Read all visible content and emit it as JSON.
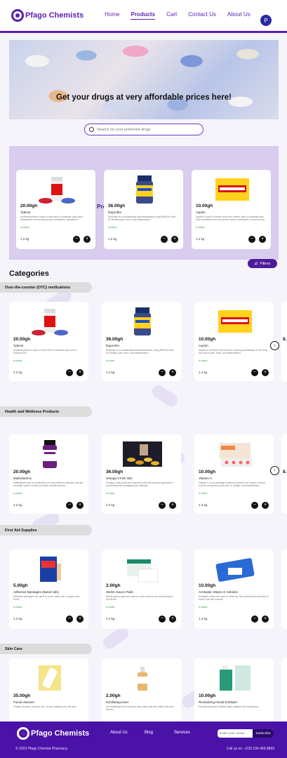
{
  "brand": {
    "name": "Pfago Chemists",
    "footer_name": "Pfago Chemists",
    "accent": "#5b1fae",
    "footer_bg": "#4b12a8"
  },
  "nav": {
    "links": [
      "Home",
      "Products",
      "Cart",
      "Contact Us",
      "About Us"
    ],
    "active": "Products",
    "avatar_initial": "P"
  },
  "hero": {
    "title": "Get your drugs at  very affordable prices here!"
  },
  "search": {
    "placeholder": "Search for your preferred drugs"
  },
  "featured": {
    "label": "Products",
    "items": [
      {
        "price": "20.00gh",
        "name": "Tylenol",
        "desc": "Acetaminophen is used to treat mild to moderate pain (from headaches, menstrual periods, toothaches, backaches, osteoarthritis, or cold/flu aches and pains) and to reduce fever.",
        "stock": "In stock",
        "weight": "1.2 kg",
        "image": "tylenol-bottle"
      },
      {
        "price": "36.00gh",
        "name": "Ibuprofen",
        "desc": "Ibuprofen is a nonsteroidal anti-inflammatory drug (NSAID) used for treating pain, fever, and inflammation.",
        "stock": "In stock",
        "weight": "1.2 kg",
        "image": "ibuprofen-bottle"
      },
      {
        "price": "10.00gh",
        "name": "Aspirin",
        "desc": "Aspirin is used to reduce fever and relieve mild to moderate pain from conditions such as muscle aches, toothaches, common cold, and headaches.",
        "stock": "In stock",
        "weight": "1.2 kg",
        "image": "aspirin-box"
      }
    ]
  },
  "filters_label": "Filters",
  "categories_title": "Categories",
  "categories": [
    {
      "name": "Over-the-counter (OTC) medications",
      "items": [
        {
          "price": "20.00gh",
          "name": "Tylenol",
          "desc": "Acetaminophen is used to treat mild to moderate pain and to reduce fever.",
          "stock": "In stock",
          "weight": "1.2 kg",
          "image": "tylenol-bottle"
        },
        {
          "price": "36.00gh",
          "name": "Ibuprofen",
          "desc": "Ibuprofen is a nonsteroidal anti-inflammatory drug (NSAID) used for treating pain, fever, and inflammation.",
          "stock": "In stock",
          "weight": "1.2 kg",
          "image": "ibuprofen-bottle"
        },
        {
          "price": "10.00gh",
          "name": "Aspirin",
          "desc": "Aspirin is a NSAID that works by reducing substances in the body that cause pain, fever, and inflammation.",
          "stock": "In stock",
          "weight": "1.2 kg",
          "image": "aspirin-box"
        }
      ],
      "peek_price": "8."
    },
    {
      "name": "Health and Wellness Products",
      "items": [
        {
          "price": "20.00gh",
          "name": "Multivitamins",
          "desc": "Multivitamins are a combination of many different vitamins that are normally found in foods and other natural sources.",
          "stock": "In stock",
          "weight": "1.2 kg",
          "image": "multivitamin-bottle"
        },
        {
          "price": "36.00gh",
          "name": "Omega-3 Fish Oils",
          "desc": "Omega-3 fatty acids are essential nutrients that are important in preventing and managing heart disease.",
          "stock": "In stock",
          "weight": "1.2 kg",
          "image": "fish-oil-capsules"
        },
        {
          "price": "10.00gh",
          "name": "Vitamin C",
          "desc": "Vitamin C is an essential nutrient involved in the repair of tissue and the enzymatic production of certain neurotransmitters.",
          "stock": "In stock",
          "weight": "1.2 kg",
          "image": "vitamin-c-box"
        }
      ],
      "peek_price": "8."
    },
    {
      "name": "First Aid Supplies",
      "items": [
        {
          "price": "5.00gh",
          "name": "Adhesive Bandages (Band-Aids)",
          "desc": "Adhesive bandages are used to cover minor cuts, scrapes and burns.",
          "stock": "In stock",
          "weight": "1.2 kg",
          "image": "band-aid-box"
        },
        {
          "price": "2.00gh",
          "name": "Sterile Gauze Pads",
          "desc": "Sterile gauze pads are used to cover wounds and absorb blood and fluids.",
          "stock": "In stock",
          "weight": "1.2 kg",
          "image": "gauze-pads"
        },
        {
          "price": "10.00gh",
          "name": "Antiseptic Wipes or Solution",
          "desc": "Antiseptic wipes are used to clean the skin and prevent infection in minor cuts and wounds.",
          "stock": "In stock",
          "weight": "1.2 kg",
          "image": "antiseptic-wipes"
        }
      ]
    },
    {
      "name": "Skin Care",
      "items": [
        {
          "price": "35.00gh",
          "name": "Facial cleanser",
          "desc": "A facial cleanser removes dirt, oil and makeup from the skin.",
          "image": "cleanser-tube"
        },
        {
          "price": "2.00gh",
          "name": "Exfoliating toner",
          "desc": "An exfoliating toner removes dead skin cells and refines the skin texture.",
          "image": "toner-bottle"
        },
        {
          "price": "10.00gh",
          "name": "Revitalizing Facial Exfoliant",
          "desc": "Revitalizing facial exfoliant helps brighten the complexion.",
          "image": "exfoliant-bottle"
        }
      ]
    }
  ],
  "footer": {
    "links": [
      "About Us",
      "Blog",
      "Services"
    ],
    "subscribe_placeholder": "Enter your email",
    "subscribe_label": "Subscribe",
    "copyright": "© 2023 Pfago Chemist Pharmacy",
    "call": "Call us on: +233 234 466 8869"
  }
}
